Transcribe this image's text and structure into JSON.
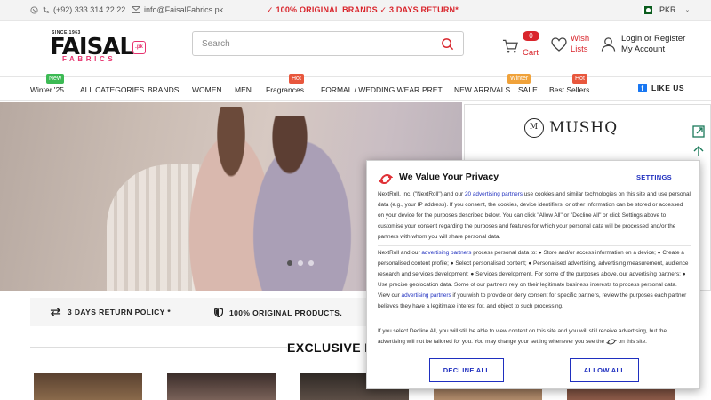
{
  "topbar": {
    "phone": "(+92) 333 314 22 22",
    "email": "info@FaisalFabrics.pk",
    "promo": "✓ 100% ORIGINAL BRANDS ✓ 3 DAYS RETURN*",
    "currency": "PKR"
  },
  "logo": {
    "since": "SINCE 1963",
    "name": "FAISAL",
    "sub": "FABRICS",
    "tld": ".pk"
  },
  "search": {
    "placeholder": "Search"
  },
  "cart": {
    "count": "0",
    "label": "Cart"
  },
  "wishlist": {
    "line1": "Wish",
    "line2": "Lists"
  },
  "account": {
    "line1": "Login or Register",
    "line2": "My Account"
  },
  "nav": {
    "items": [
      "Winter '25",
      "ALL CATEGORIES",
      "BRANDS",
      "WOMEN",
      "MEN",
      "Fragrances",
      "FORMAL / WEDDING WEAR",
      "PRET",
      "NEW ARRIVALS",
      "SALE",
      "Best Sellers"
    ],
    "badges": {
      "new": "New",
      "hot1": "Hot",
      "winter": "Winter",
      "hot2": "Hot"
    },
    "like_us": "LIKE US"
  },
  "promo_panel": {
    "brand": "MUSHQ",
    "monogram": "M"
  },
  "features": {
    "returns": "3 DAYS RETURN POLICY *",
    "original": "100% ORIGINAL PRODUCTS."
  },
  "section_title": "EXCLUSIVE LA",
  "consent": {
    "title": "We Value Your Privacy",
    "settings": "SETTINGS",
    "p1_a": "NextRoll, Inc. (\"NextRoll\") and our ",
    "p1_link": "20 advertising partners",
    "p1_b": " use cookies and similar technologies on this site and use personal data (e.g., your IP address). If you consent, the cookies, device identifiers, or other information can be stored or accessed on your device for the purposes described below. You can click \"Allow All\" or \"Decline All\" or click Settings above to customise your consent regarding the purposes and features for which your personal data will be processed and/or the partners with whom you will share personal data.",
    "p2_a": "NextRoll and our ",
    "p2_link1": "advertising partners",
    "p2_b": " process personal data to: ● Store and/or access information on a device; ● Create a personalised content profile; ● Select personalised content; ● Personalised advertising, advertising measurement, audience research and services development; ● Services development. For some of the purposes above, our advertising partners: ● Use precise geolocation data. Some of our partners rely on their legitimate business interests to process personal data. View our ",
    "p2_link2": "advertising partners",
    "p2_c": " if you wish to provide or deny consent for specific partners, review the purposes each partner believes they have a legitimate interest for, and object to such processing.",
    "p3_a": "If you select Decline All, you will still be able to view content on this site and you will still receive advertising, but the advertising will not be tailored for you. You may change your setting whenever you see the ",
    "p3_b": " on this site.",
    "decline": "DECLINE ALL",
    "allow": "ALLOW ALL"
  },
  "colors": {
    "accent": "#d9252c",
    "brand_pink": "#e7336f",
    "link_blue": "#1f2fbf",
    "badge_green": "#3cba54",
    "badge_orange": "#f0a23a",
    "badge_red": "#e8573d"
  }
}
